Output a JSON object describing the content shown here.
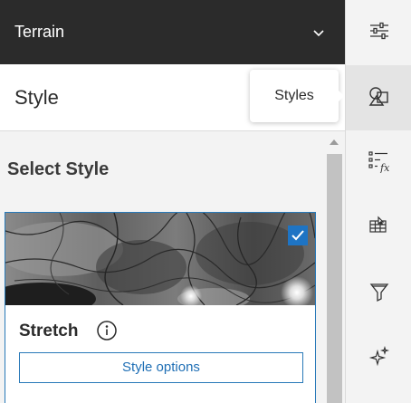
{
  "layer": {
    "title": "Terrain"
  },
  "style_panel": {
    "title": "Style",
    "section_title": "Select Style",
    "card": {
      "name": "Stretch",
      "selected": true,
      "button_label": "Style options"
    }
  },
  "tooltip": {
    "text": "Styles"
  },
  "toolbar": {
    "items": [
      {
        "name": "properties",
        "icon": "sliders-icon"
      },
      {
        "name": "styles",
        "icon": "shapes-icon",
        "active": true
      },
      {
        "name": "fields",
        "icon": "list-fx-icon"
      },
      {
        "name": "raster-functions",
        "icon": "grid-cursor-icon"
      },
      {
        "name": "filter",
        "icon": "filter-icon"
      },
      {
        "name": "effects",
        "icon": "sparkle-icon"
      }
    ]
  },
  "colors": {
    "accent": "#1e74c4",
    "header_bg": "#2b2b2b",
    "panel_bg": "#f3f3f3"
  }
}
